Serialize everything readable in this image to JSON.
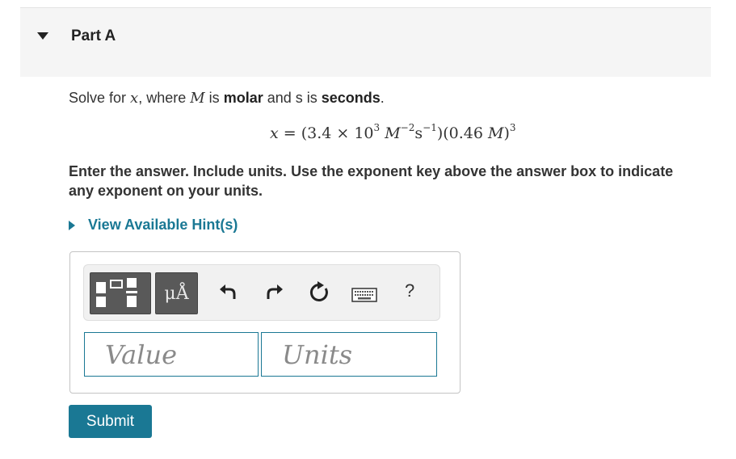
{
  "part": {
    "title": "Part A"
  },
  "question": {
    "p1": "Solve for ",
    "var_x": "x",
    "p2": ", where ",
    "var_M": "M",
    "p3": " is ",
    "molar": "molar",
    "p4": " and s is ",
    "seconds": "seconds",
    "p5": "."
  },
  "equation": {
    "lhs": "x",
    "eq": " = (3.4 × 10",
    "exp1": "3",
    "M1": " M",
    "exp2": "−2",
    "s": "s",
    "exp3": "−1",
    "mid": ")(0.46 ",
    "M2": "M",
    "close": ")",
    "exp4": "3"
  },
  "instructions": {
    "line1": "Enter the answer. Include units. Use the exponent key above the answer box to indicate",
    "line2": "any exponent on your units."
  },
  "hint": {
    "label": "View Available Hint(s)"
  },
  "toolbar": {
    "units_label": "μÅ",
    "help_label": "?",
    "icons": [
      "templates-icon",
      "undo-icon",
      "redo-icon",
      "reset-icon",
      "keyboard-icon"
    ]
  },
  "inputs": {
    "value_placeholder": "Value",
    "units_placeholder": "Units",
    "value": "",
    "units": ""
  },
  "submit": {
    "label": "Submit"
  },
  "colors": {
    "accent": "#1a7894",
    "header_bg": "#f5f5f5",
    "tool_bg": "#595959"
  }
}
